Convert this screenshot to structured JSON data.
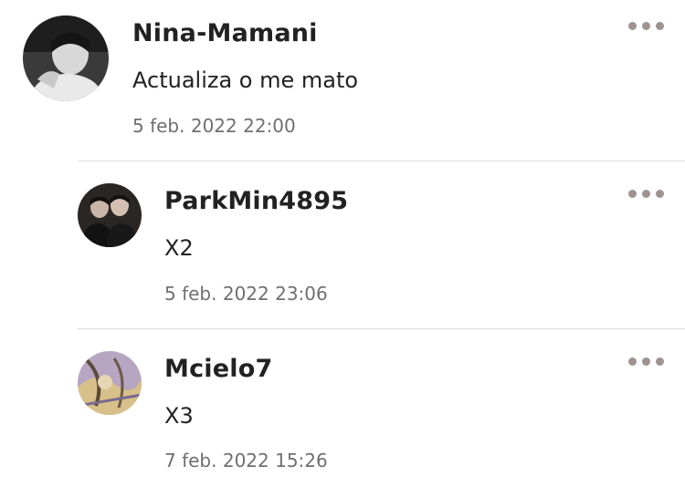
{
  "comments": [
    {
      "username": "Nina-Mamani",
      "text": "Actualiza o me mato",
      "timestamp": "5 feb. 2022 22:00",
      "avatar_icon": "user-avatar-photo-grayscale"
    },
    {
      "username": "ParkMin4895",
      "text": "X2",
      "timestamp": "5 feb. 2022 23:06",
      "avatar_icon": "user-avatar-photo-dark"
    },
    {
      "username": "Mcielo7",
      "text": "X3",
      "timestamp": "7 feb. 2022 15:26",
      "avatar_icon": "user-avatar-illustration"
    }
  ],
  "colors": {
    "username": "#222222",
    "timestamp": "#6f6f6f",
    "more_dots": "#9e948f",
    "divider": "#dddddd"
  },
  "icons": {
    "more_options": "more-options-icon"
  }
}
